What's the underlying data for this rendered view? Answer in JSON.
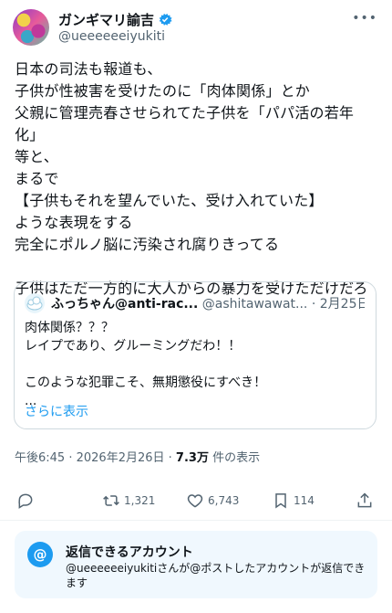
{
  "author": {
    "display_name": "ガンギマリ諭吉",
    "handle": "@ueeeeeeiyukiti",
    "verified": true
  },
  "post": {
    "text": "日本の司法も報道も、\n子供が性被害を受けたのに「肉体関係」とか\n父親に管理売春させられてた子供を「パパ活の若年化」\n等と、\nまるで\n【子供もそれを望んでいた、受け入れていた】\nような表現をする\n完全にポルノ脳に汚染され腐りきってる\n\n子供はただ一方的に大人からの暴力を受けただけだろ"
  },
  "quote": {
    "name": "ふっちゃん@anti-rac...",
    "handle": "@ashitawawat...",
    "date": "2月25日",
    "text": "肉体関係？？？\nレイプであり、グルーミングだわ！！\n\nこのような犯罪こそ、無期懲役にすべき！\n...",
    "show_more": "さらに表示"
  },
  "meta": {
    "time": "午後6:45",
    "date": "2026年2月26日",
    "views_count": "7.3万",
    "views_label": "件の表示"
  },
  "actions": {
    "retweets": "1,321",
    "likes": "6,743",
    "bookmarks": "114"
  },
  "reply_settings": {
    "icon": "@",
    "title": "返信できるアカウント",
    "description": "@ueeeeeeiyukitiさんが@ポストしたアカウントが返信できます"
  },
  "colors": {
    "accent": "#1d9bf0",
    "text": "#0f1419",
    "muted": "#536471",
    "reply_bg": "#f0f8fe"
  },
  "icons": [
    "verified-badge-icon",
    "more-icon",
    "reply-icon",
    "retweet-icon",
    "like-icon",
    "bookmark-icon",
    "share-icon",
    "at-icon"
  ]
}
